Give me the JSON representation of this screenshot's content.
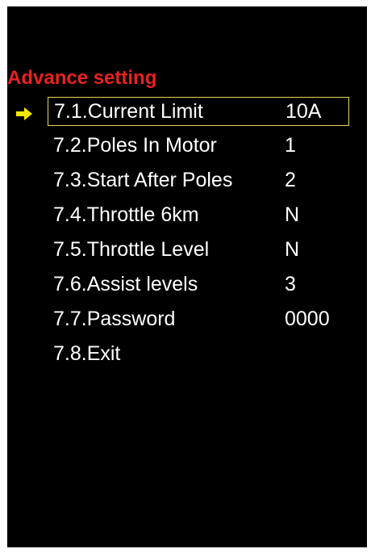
{
  "screen": {
    "title": "Advance setting",
    "cursor_icon": "arrow-right-icon",
    "colors": {
      "background": "#000000",
      "title": "#e8231f",
      "text": "#ffffff",
      "selection_border": "#e6d65a",
      "cursor": "#f5e600"
    }
  },
  "menu": {
    "items": [
      {
        "label": "7.1.Current Limit",
        "value": "10A",
        "selected": true
      },
      {
        "label": "7.2.Poles In Motor",
        "value": "1"
      },
      {
        "label": "7.3.Start After Poles",
        "value": "2"
      },
      {
        "label": "7.4.Throttle 6km",
        "value": "N"
      },
      {
        "label": "7.5.Throttle Level",
        "value": "N"
      },
      {
        "label": "7.6.Assist levels",
        "value": "3"
      },
      {
        "label": "7.7.Password",
        "value": "0000"
      },
      {
        "label": "7.8.Exit",
        "value": ""
      }
    ]
  }
}
